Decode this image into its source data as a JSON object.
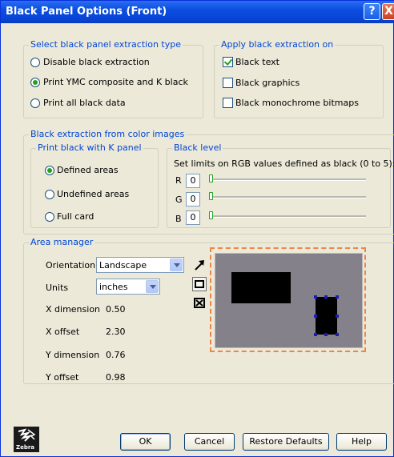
{
  "window": {
    "title": "Black Panel Options (Front)",
    "help_glyph": "?",
    "close_glyph": "X"
  },
  "extraction_type": {
    "legend": "Select black panel extraction type",
    "options": [
      {
        "label": "Disable black extraction",
        "selected": false
      },
      {
        "label": "Print YMC composite and K black",
        "selected": true
      },
      {
        "label": "Print all black data",
        "selected": false
      }
    ]
  },
  "apply_on": {
    "legend": "Apply black extraction on",
    "options": [
      {
        "label": "Black text",
        "checked": true
      },
      {
        "label": "Black graphics",
        "checked": false
      },
      {
        "label": "Black monochrome bitmaps",
        "checked": false
      }
    ]
  },
  "color_images": {
    "legend": "Black extraction from color images",
    "k_panel": {
      "legend": "Print black with K panel",
      "options": [
        {
          "label": "Defined areas",
          "selected": true
        },
        {
          "label": "Undefined areas",
          "selected": false
        },
        {
          "label": "Full card",
          "selected": false
        }
      ]
    },
    "black_level": {
      "legend": "Black level",
      "description": "Set limits on RGB values defined as black (0 to 5):",
      "channels": [
        {
          "label": "R",
          "value": "0",
          "level": 0
        },
        {
          "label": "G",
          "value": "0",
          "level": 0
        },
        {
          "label": "B",
          "value": "0",
          "level": 0
        }
      ]
    }
  },
  "area_manager": {
    "legend": "Area manager",
    "orientation_label": "Orientation",
    "orientation_value": "Landscape",
    "units_label": "Units",
    "units_value": "inches",
    "x_dimension_label": "X dimension",
    "x_dimension_value": "0.50",
    "x_offset_label": "X offset",
    "x_offset_value": "2.30",
    "y_dimension_label": "Y dimension",
    "y_dimension_value": "0.76",
    "y_offset_label": "Y offset",
    "y_offset_value": "0.98",
    "tools": [
      "pointer-arrow-icon",
      "rectangle-tool-icon",
      "delete-area-icon"
    ]
  },
  "footer": {
    "logo_text": "Zebra",
    "ok": "OK",
    "cancel": "Cancel",
    "restore": "Restore Defaults",
    "help": "Help"
  },
  "colors": {
    "title_bar": "#0a4ee0",
    "group_legend": "#0046d5",
    "radio_dot": "#21a121",
    "preview_border": "#ee8649",
    "preview_fill": "#84818a"
  }
}
